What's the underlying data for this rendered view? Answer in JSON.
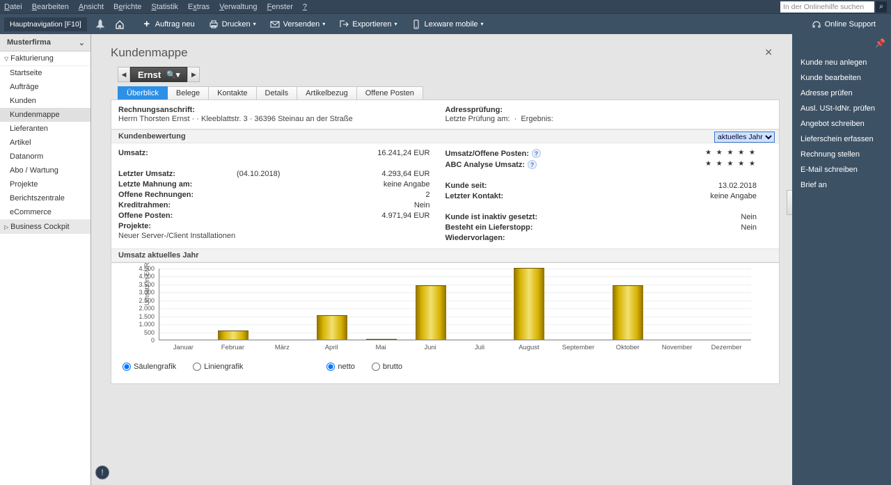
{
  "menubar": {
    "items": [
      "Datei",
      "Bearbeiten",
      "Ansicht",
      "Berichte",
      "Statistik",
      "Extras",
      "Verwaltung",
      "Fenster",
      "?"
    ],
    "search_placeholder": "In der Onlinehilfe suchen"
  },
  "toolbar": {
    "nav_label": "Hauptnavigation [F10]",
    "new_order": "Auftrag neu",
    "print": "Drucken",
    "send": "Versenden",
    "export": "Exportieren",
    "mobile": "Lexware mobile",
    "support": "Online Support"
  },
  "left_nav": {
    "company": "Musterfirma",
    "group1": "Fakturierung",
    "items1": [
      "Startseite",
      "Aufträge",
      "Kunden",
      "Kundenmappe",
      "Lieferanten",
      "Artikel",
      "Datanorm",
      "Abo / Wartung",
      "Projekte",
      "Berichtszentrale",
      "eCommerce"
    ],
    "group2": "Business Cockpit"
  },
  "page": {
    "title": "Kundenmappe",
    "customer_name": "Ernst"
  },
  "tabs": [
    "Überblick",
    "Belege",
    "Kontakte",
    "Details",
    "Artikelbezug",
    "Offene Posten"
  ],
  "address": {
    "h1": "Rechnungsanschrift:",
    "line": "Herrn Thorsten Ernst ·   · Kleeblattstr. 3 · 36396 Steinau an der Straße",
    "h2": "Adressprüfung:",
    "line2a": "Letzte Prüfung am:",
    "line2b": "Ergebnis:"
  },
  "eval": {
    "header": "Kundenbewertung",
    "period_options": [
      "aktuelles Jahr"
    ],
    "left": [
      {
        "k": "Umsatz:",
        "v": "16.241,24 EUR"
      },
      {
        "k": "",
        "v": ""
      },
      {
        "k": "Letzter Umsatz:",
        "note": "(04.10.2018)",
        "v": "4.293,64 EUR"
      },
      {
        "k": "Letzte Mahnung am:",
        "v": "keine Angabe"
      },
      {
        "k": "Offene Rechnungen:",
        "v": "2"
      },
      {
        "k": "Kreditrahmen:",
        "v": "Nein"
      },
      {
        "k": "Offene Posten:",
        "v": "4.971,94 EUR"
      },
      {
        "k": "Projekte:",
        "v": ""
      }
    ],
    "project_line": "Neuer Server-/Client Installationen",
    "right": [
      {
        "k": "Umsatz/Offene Posten:",
        "icon": true,
        "stars": true
      },
      {
        "k": "ABC Analyse Umsatz:",
        "icon": true,
        "stars": true
      },
      {
        "k": "",
        "v": ""
      },
      {
        "k": "Kunde seit:",
        "v": "13.02.2018"
      },
      {
        "k": "Letzter Kontakt:",
        "v": "keine Angabe"
      },
      {
        "k": "",
        "v": ""
      },
      {
        "k": "Kunde ist inaktiv gesetzt:",
        "v": "Nein"
      },
      {
        "k": "Besteht ein Lieferstopp:",
        "v": "Nein"
      },
      {
        "k": "Wiedervorlagen:",
        "v": ""
      }
    ]
  },
  "chart_header": "Umsatz aktuelles Jahr",
  "chart_data": {
    "type": "bar",
    "title": "Umsatz aktuelles Jahr",
    "xlabel": "",
    "ylabel": "Umsatz in EUR",
    "ylim": [
      0,
      4500
    ],
    "yticks": [
      0,
      500,
      1000,
      1500,
      2000,
      2500,
      3000,
      3500,
      4000,
      4500
    ],
    "categories": [
      "Januar",
      "Februar",
      "März",
      "April",
      "Mai",
      "Juni",
      "Juli",
      "August",
      "September",
      "Oktober",
      "November",
      "Dezember"
    ],
    "values": [
      0,
      550,
      0,
      1550,
      30,
      3400,
      0,
      4550,
      0,
      3400,
      0,
      0
    ]
  },
  "chart_opts": {
    "g1a": "Säulengrafik",
    "g1b": "Liniengrafik",
    "g2a": "netto",
    "g2b": "brutto"
  },
  "right_actions": [
    "Kunde neu anlegen",
    "Kunde bearbeiten",
    "Adresse prüfen",
    "Ausl. USt-IdNr. prüfen",
    "Angebot schreiben",
    "Lieferschein erfassen",
    "Rechnung stellen",
    "E-Mail schreiben",
    "Brief an"
  ]
}
